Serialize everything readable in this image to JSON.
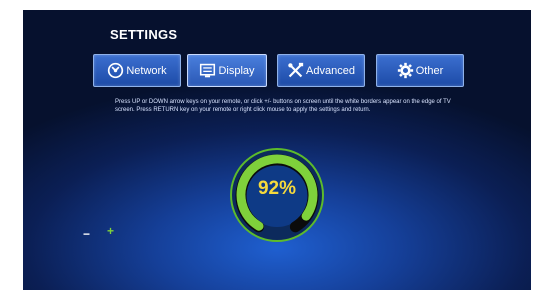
{
  "settings": {
    "title": "SETTINGS"
  },
  "tabs": [
    {
      "label": "Network",
      "icon": "network-icon"
    },
    {
      "label": "Display",
      "icon": "display-icon",
      "active": true
    },
    {
      "label": "Advanced",
      "icon": "wrench-screwdriver-icon"
    },
    {
      "label": "Other",
      "icon": "gear-icon"
    }
  ],
  "help_text": "Press UP or DOWN arrow keys on your remote, or click +/- buttons on screen until the white borders appear on the edge of TV screen. Press RETURN key on your remote or right click mouse to apply the settings and return.",
  "dial": {
    "value_label": "92%",
    "value_fraction": 0.92,
    "minus_label": "−",
    "plus_label": "+",
    "track_color": "#0b0b0b",
    "fill_color": "#7fd13b",
    "ring_color": "#5dbb2b"
  }
}
